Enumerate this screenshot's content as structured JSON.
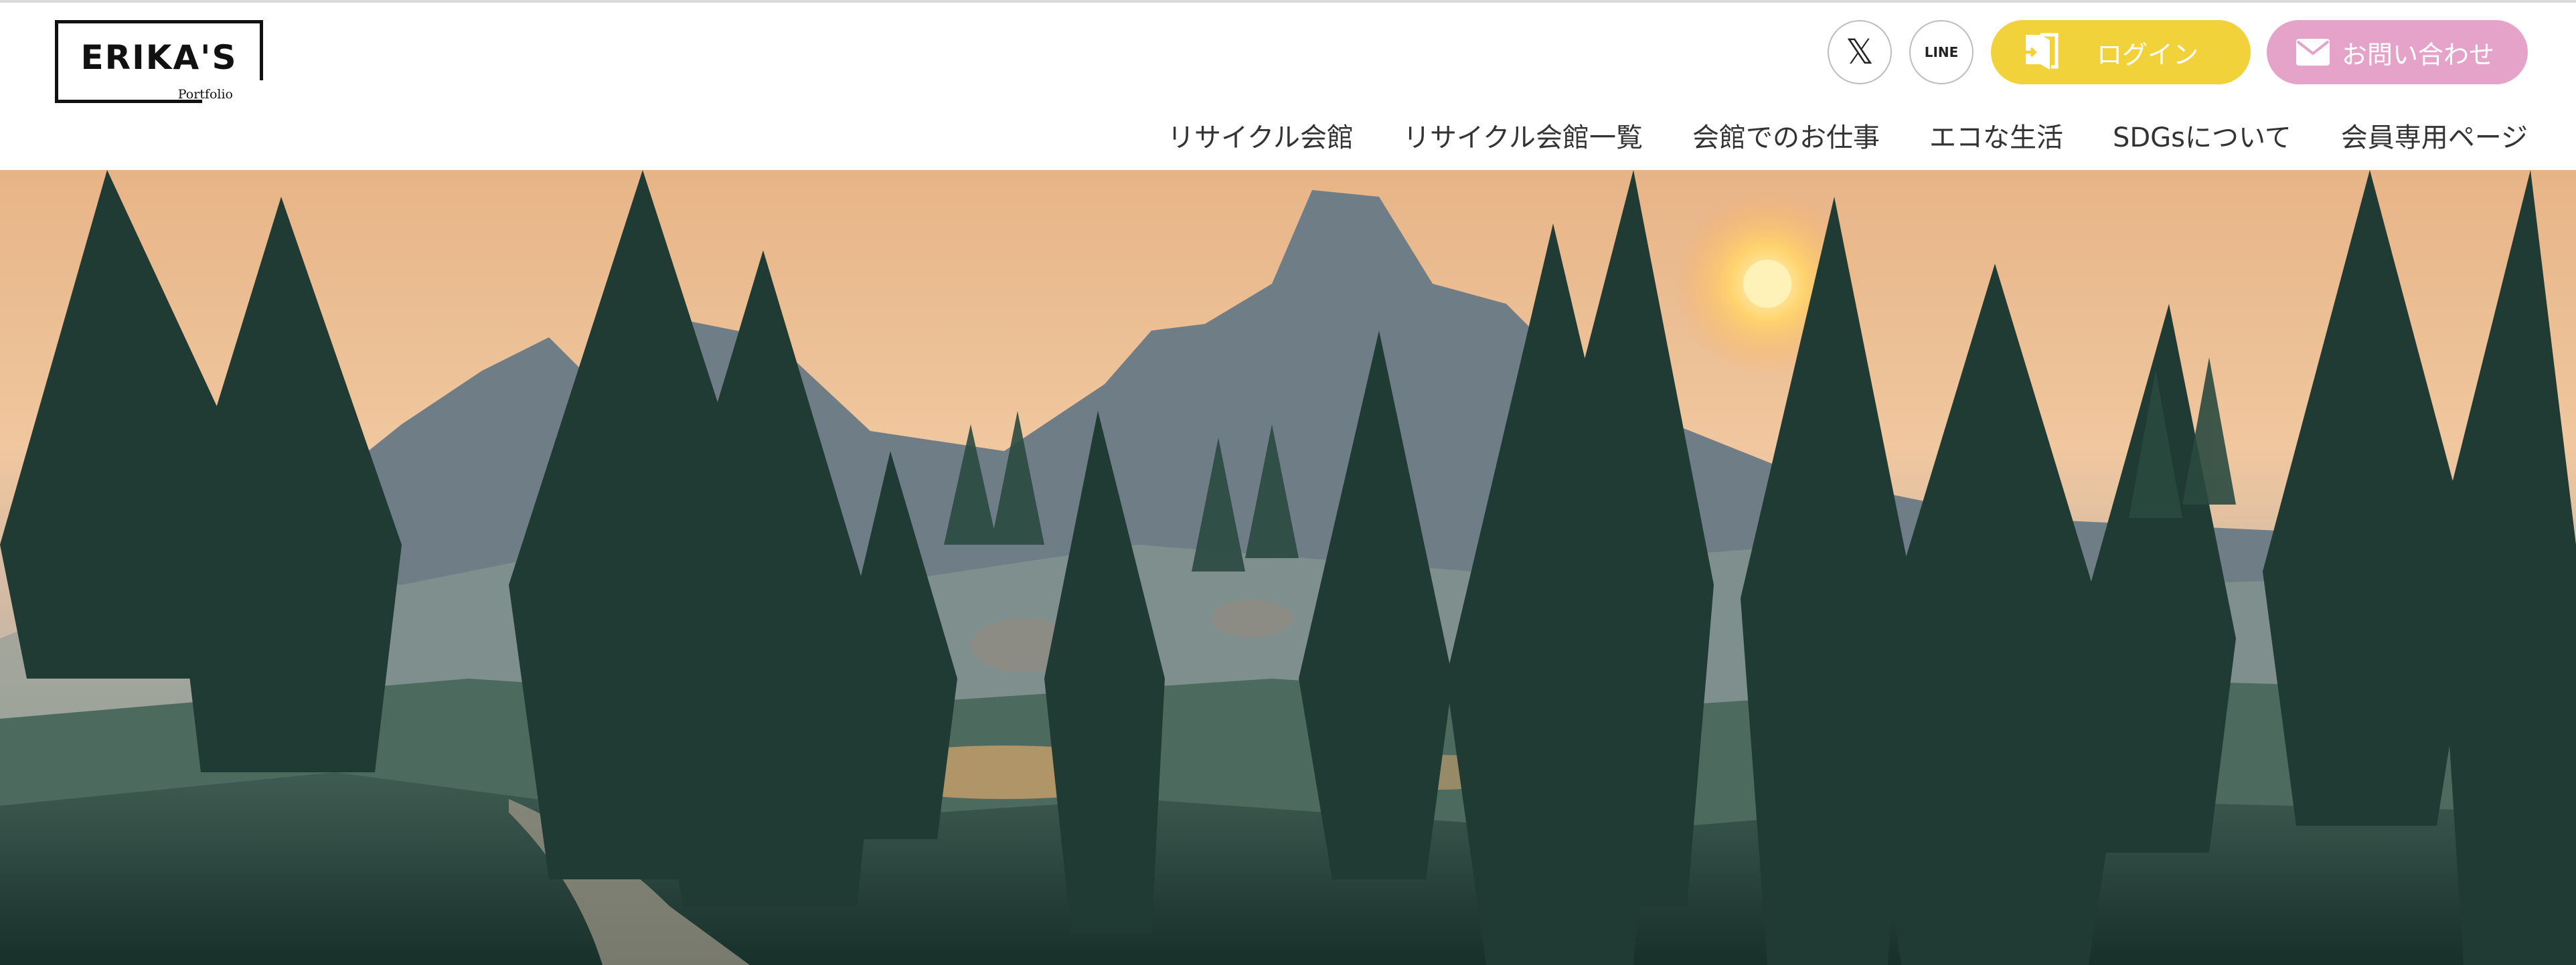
{
  "header": {
    "logo": {
      "title": "ERIKA'S",
      "subtitle": "Portfolio"
    },
    "social": [
      {
        "name": "x",
        "label": "𝕏",
        "icon": "x-logo-icon"
      },
      {
        "name": "line",
        "label": "LINE",
        "icon": "line-logo-icon"
      }
    ],
    "login_label": "ログイン",
    "contact_label": "お問い合わせ",
    "nav": [
      "リサイクル会館",
      "リサイクル会館一覧",
      "会館でのお仕事",
      "エコな生活",
      "SDGsについて",
      "会員専用ページ"
    ]
  },
  "colors": {
    "login": "#f2d23a",
    "contact": "#e6a3c9",
    "nav_text": "#333333"
  },
  "hero": {
    "image": "forest-mountain-sunset"
  }
}
